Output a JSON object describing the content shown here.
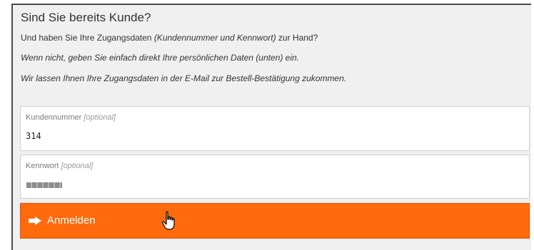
{
  "login_section": {
    "title": "Sind Sie bereits Kunde?",
    "intro": {
      "prefix": "Und haben Sie Ihre Zugangsdaten ",
      "italic": "(Kundennummer und Kennwort)",
      "suffix": " zur Hand?"
    },
    "note_line_1": "Wenn nicht, geben Sie einfach direkt Ihre persönlichen Daten (unten) ein.",
    "note_line_2": "Wir lassen Ihnen Ihre Zugangsdaten in der E-Mail zur Bestell-Bestätigung zukommen."
  },
  "customer_number_field": {
    "label": "Kundennummer",
    "optional": "[optional]",
    "value": "314"
  },
  "password_field": {
    "label": "Kennwort",
    "optional": "[optional]"
  },
  "login_button": {
    "label": "Anmelden",
    "icon": "arrow-right-icon",
    "background": "#ff6a0d"
  },
  "cursor": {
    "icon": "hand-pointer-icon"
  }
}
